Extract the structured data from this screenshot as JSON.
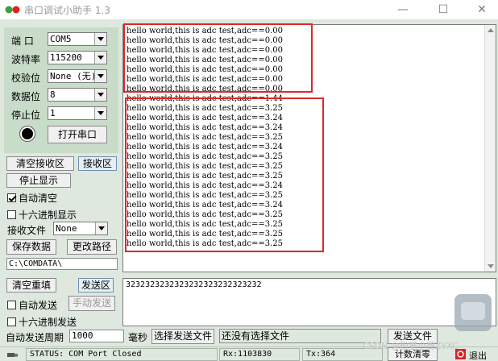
{
  "window": {
    "title": "串口调试小助手 1.3",
    "minimize": "—",
    "maximize": "☐",
    "close": "✕"
  },
  "settings": {
    "port_label": "端  口",
    "port_value": "COM5",
    "baud_label": "波特率",
    "baud_value": "115200",
    "parity_label": "校验位",
    "parity_value": "None (无)",
    "databits_label": "数据位",
    "databits_value": "8",
    "stopbits_label": "停止位",
    "stopbits_value": "1",
    "open_port_button": "打开串口"
  },
  "receive": {
    "clear_button": "清空接收区",
    "area_label": "接收区",
    "stop_display_button": "停止显示",
    "auto_clear_label": "自动清空",
    "auto_clear_checked": true,
    "hex_display_label": "十六进制显示",
    "hex_display_checked": false,
    "recv_file_label": "接收文件",
    "recv_file_value": "None",
    "save_data_button": "保存数据",
    "change_path_button": "更改路径",
    "path_value": "C:\\COMDATA\\",
    "lines": [
      "hello world,this is adc test,adc==0.00",
      "hello world,this is adc test,adc==0.00",
      "hello world,this is adc test,adc==0.00",
      "hello world,this is adc test,adc==0.00",
      "hello world,this is adc test,adc==0.00",
      "hello world,this is adc test,adc==0.00",
      "hello world,this is adc test,adc==0.00",
      "hello world,this is adc test,adc==1.44",
      "hello world,this is adc test,adc==3.25",
      "hello world,this is adc test,adc==3.24",
      "hello world,this is adc test,adc==3.24",
      "hello world,this is adc test,adc==3.25",
      "hello world,this is adc test,adc==3.24",
      "hello world,this is adc test,adc==3.25",
      "hello world,this is adc test,adc==3.25",
      "hello world,this is adc test,adc==3.25",
      "hello world,this is adc test,adc==3.24",
      "hello world,this is adc test,adc==3.25",
      "hello world,this is adc test,adc==3.24",
      "hello world,this is adc test,adc==3.25",
      "hello world,this is adc test,adc==3.25",
      "hello world,this is adc test,adc==3.25",
      "hello world,this is adc test,adc==3.25"
    ]
  },
  "send": {
    "clear_button": "清空重填",
    "area_label": "发送区",
    "auto_send_label": "自动发送",
    "auto_send_checked": false,
    "manual_send_button": "手动发送",
    "hex_send_label": "十六进制发送",
    "hex_send_checked": false,
    "period_label": "自动发送周期",
    "period_value": "1000",
    "ms_label": "毫秒",
    "select_file_button": "选择发送文件",
    "file_status": "还没有选择文件",
    "send_file_button": "发送文件",
    "send_text": "3232323232323232323232323232"
  },
  "statusbar": {
    "status": "STATUS: COM Port Closed",
    "rx": "Rx:1103830",
    "tx": "Tx:364",
    "reset_count_button": "计数清零",
    "exit_button": "退出"
  },
  "watermark": "CSDN @粉墨小哥ZYXC"
}
